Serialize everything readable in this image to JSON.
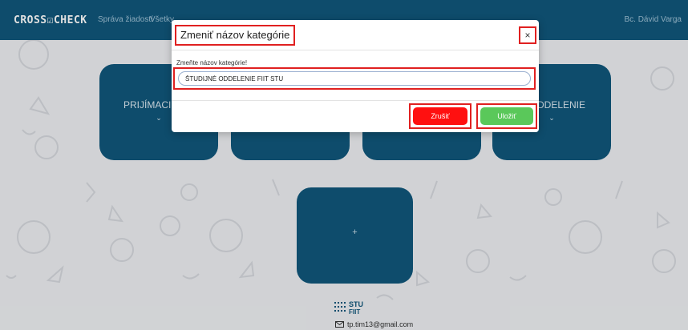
{
  "navbar": {
    "brand": "CROSS☑CHECK",
    "links": [
      "Správa žiadostí",
      "Všetky"
    ],
    "user": "Bc. Dávid Varga"
  },
  "tiles": [
    {
      "title": "PRIJÍMACIE KO",
      "chevron": "⌄"
    },
    {
      "title": "",
      "chevron": ""
    },
    {
      "title": "",
      "chevron": ""
    },
    {
      "title": "IÉ ODDELENIE",
      "chevron": "⌄"
    }
  ],
  "add_tile": {
    "label": "+"
  },
  "footer": {
    "logo_top": "STU",
    "logo_bottom": "FIIT",
    "email": "tp.tim13@gmail.com"
  },
  "modal": {
    "title": "Zmeniť názov kategórie",
    "close_label": "×",
    "field_label": "Zmeňte názov kategórie!",
    "field_value": "ŠTUDIJNÉ ODDELENIE FIIT STU",
    "cancel_label": "Zrušiť",
    "save_label": "Uložiť"
  },
  "colors": {
    "navbar": "#10577b",
    "cancel": "#ff1010",
    "save": "#5ac85a",
    "highlight": "#e02020"
  }
}
